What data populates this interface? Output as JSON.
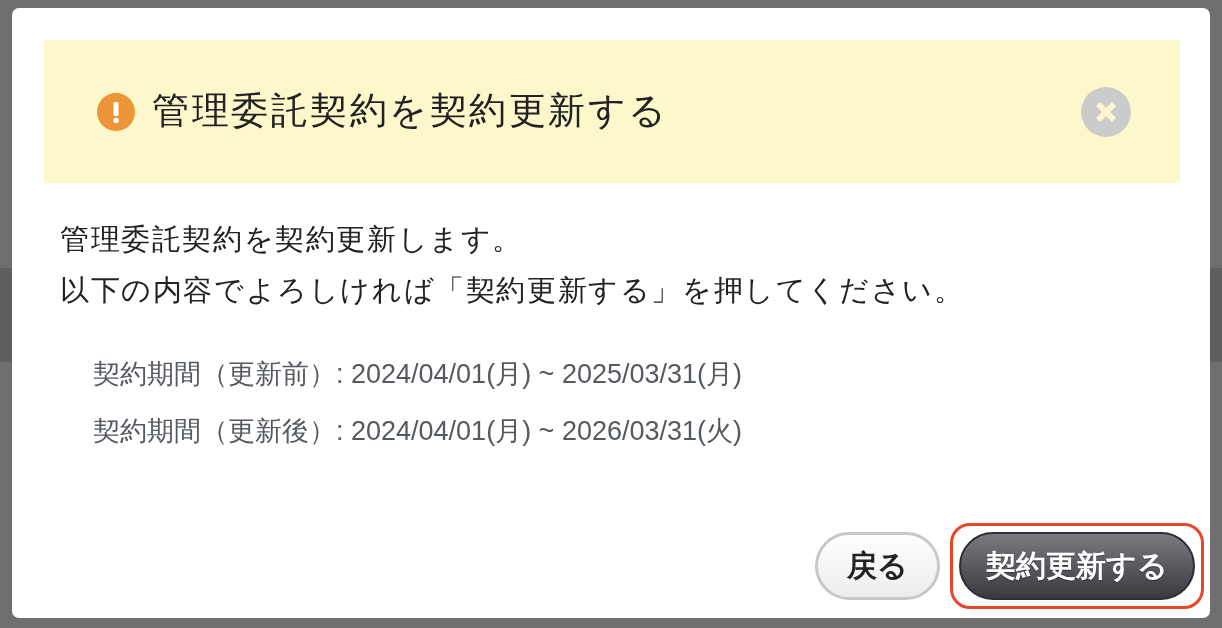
{
  "dialog": {
    "title": "管理委託契約を契約更新する",
    "message": [
      "管理委託契約を契約更新します。",
      "以下の内容でよろしければ「契約更新する」を押してください。"
    ],
    "details": [
      "契約期間（更新前）: 2024/04/01(月) ~ 2025/03/31(月)",
      "契約期間（更新後）: 2024/04/01(月) ~ 2026/03/31(火)"
    ],
    "buttons": [
      {
        "label": "戻る",
        "kind": "secondary",
        "highlighted": false
      },
      {
        "label": "契約更新する",
        "kind": "primary",
        "highlighted": true
      }
    ]
  }
}
